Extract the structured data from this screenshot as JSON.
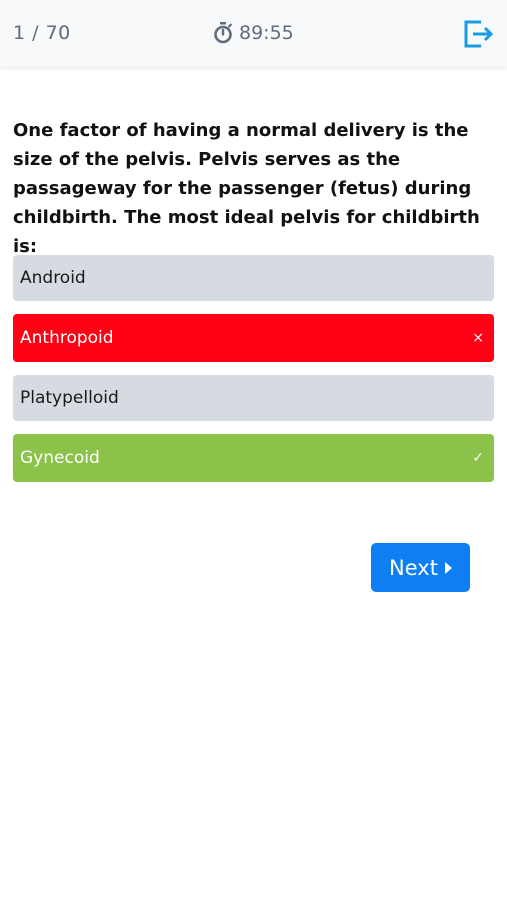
{
  "header": {
    "counter": "1 / 70",
    "timer": "89:55",
    "icons": {
      "timer": "stopwatch-icon",
      "exit": "exit-icon"
    }
  },
  "question": {
    "text": "One factor of having a normal delivery is the size of the pelvis. Pelvis serves as the passageway for the passenger (fetus) during childbirth. The most ideal pelvis for childbirth is:"
  },
  "options": [
    {
      "label": "Android",
      "state": "neutral"
    },
    {
      "label": "Anthropoid",
      "state": "wrong",
      "mark": "×"
    },
    {
      "label": "Platypelloid",
      "state": "neutral"
    },
    {
      "label": "Gynecoid",
      "state": "correct",
      "mark": "✓"
    }
  ],
  "footer": {
    "next_label": "Next"
  },
  "colors": {
    "accent": "#0d7ff2",
    "wrong": "#ff0015",
    "correct": "#8bc34a",
    "neutral": "#d6dae1",
    "exit_icon": "#1a9be6"
  }
}
